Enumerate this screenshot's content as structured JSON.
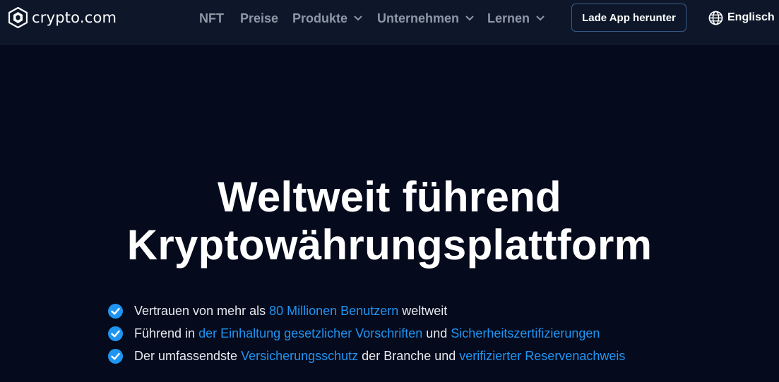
{
  "header": {
    "logo_text": "crypto.com",
    "nav": [
      {
        "label": "NFT",
        "has_dropdown": false
      },
      {
        "label": "Preise",
        "has_dropdown": false
      },
      {
        "label": "Produkte",
        "has_dropdown": true
      },
      {
        "label": "Unternehmen",
        "has_dropdown": true
      },
      {
        "label": "Lernen",
        "has_dropdown": true
      }
    ],
    "download_button": "Lade App herunter",
    "language": {
      "label": "Englisch",
      "icon": "globe-icon"
    }
  },
  "hero": {
    "title_line1": "Weltweit führend",
    "title_line2": "Kryptowährungsplattform",
    "features": [
      {
        "icon": "check-circle-icon",
        "parts": [
          "Vertrauen von mehr als ",
          "80 Millionen Benutzern",
          " weltweit"
        ]
      },
      {
        "icon": "check-circle-icon",
        "parts": [
          "Führend in ",
          "der Einhaltung gesetzlicher Vorschriften",
          " und ",
          "Sicherheitszertifizierungen"
        ]
      },
      {
        "icon": "check-circle-icon",
        "parts": [
          "Der umfassendste ",
          "Versicherungsschutz",
          " der Branche und ",
          "verifizierter Reservenachweis"
        ]
      }
    ]
  },
  "colors": {
    "background": "#050a1c",
    "header_bg": "#0d1729",
    "nav_text": "#8f97a6",
    "link": "#1f95f2",
    "check": "#1f95f2"
  }
}
